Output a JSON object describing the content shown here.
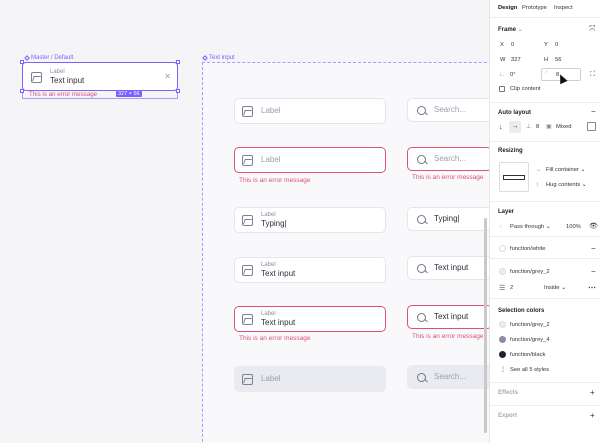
{
  "canvas": {
    "master_label": "Master / Default",
    "master_field": {
      "label": "Label",
      "value": "Text input"
    },
    "master_error": "This is an error message",
    "size_badge": "327 × 56",
    "frame_label": "Text input",
    "rows": [
      {
        "left": {
          "placeholder": "Label"
        },
        "right": {
          "placeholder": "Search..."
        }
      },
      {
        "left": {
          "placeholder": "Label"
        },
        "right": {
          "placeholder": "Search..."
        },
        "error": "This is an error message",
        "error_right": "This is an error message"
      },
      {
        "left": {
          "label": "Label",
          "value": "Typing|"
        },
        "right": {
          "value": "Typing|"
        }
      },
      {
        "left": {
          "label": "Label",
          "value": "Text input"
        },
        "right": {
          "value": "Text input"
        }
      },
      {
        "left": {
          "label": "Label",
          "value": "Text input"
        },
        "right": {
          "value": "Text input"
        },
        "error": "This is an error message",
        "error_right": "This is an error message"
      },
      {
        "left": {
          "placeholder": "Label"
        },
        "right": {
          "placeholder": "Search..."
        }
      }
    ]
  },
  "panel": {
    "tabs": [
      "Design",
      "Prototype",
      "Inspect"
    ],
    "frame": {
      "title": "Frame",
      "x_label": "X",
      "x_value": "0",
      "y_label": "Y",
      "y_value": "0",
      "w_label": "W",
      "w_value": "327",
      "h_label": "H",
      "h_value": "56",
      "rotation": "0°",
      "radius": "8",
      "clip_content": "Clip content"
    },
    "auto_layout": {
      "title": "Auto layout",
      "spacing": "8",
      "padding": "Mixed"
    },
    "resizing": {
      "title": "Resizing",
      "horizontal": "Fill container",
      "vertical": "Hug contents"
    },
    "layer": {
      "title": "Layer",
      "blend": "Pass through",
      "opacity": "100%",
      "fill_1": "function/white",
      "fill_2": "function/grey_2",
      "stroke_width": "2",
      "stroke_position": "Inside"
    },
    "selection_colors": {
      "title": "Selection colors",
      "items": [
        {
          "name": "function/grey_2",
          "color": "#eceef3"
        },
        {
          "name": "function/grey_4",
          "color": "#8b8fa6"
        },
        {
          "name": "function/black",
          "color": "#1f2433"
        }
      ],
      "see_all": "See all 5 styles"
    },
    "effects": {
      "title": "Effects"
    },
    "export": {
      "title": "Export"
    }
  }
}
